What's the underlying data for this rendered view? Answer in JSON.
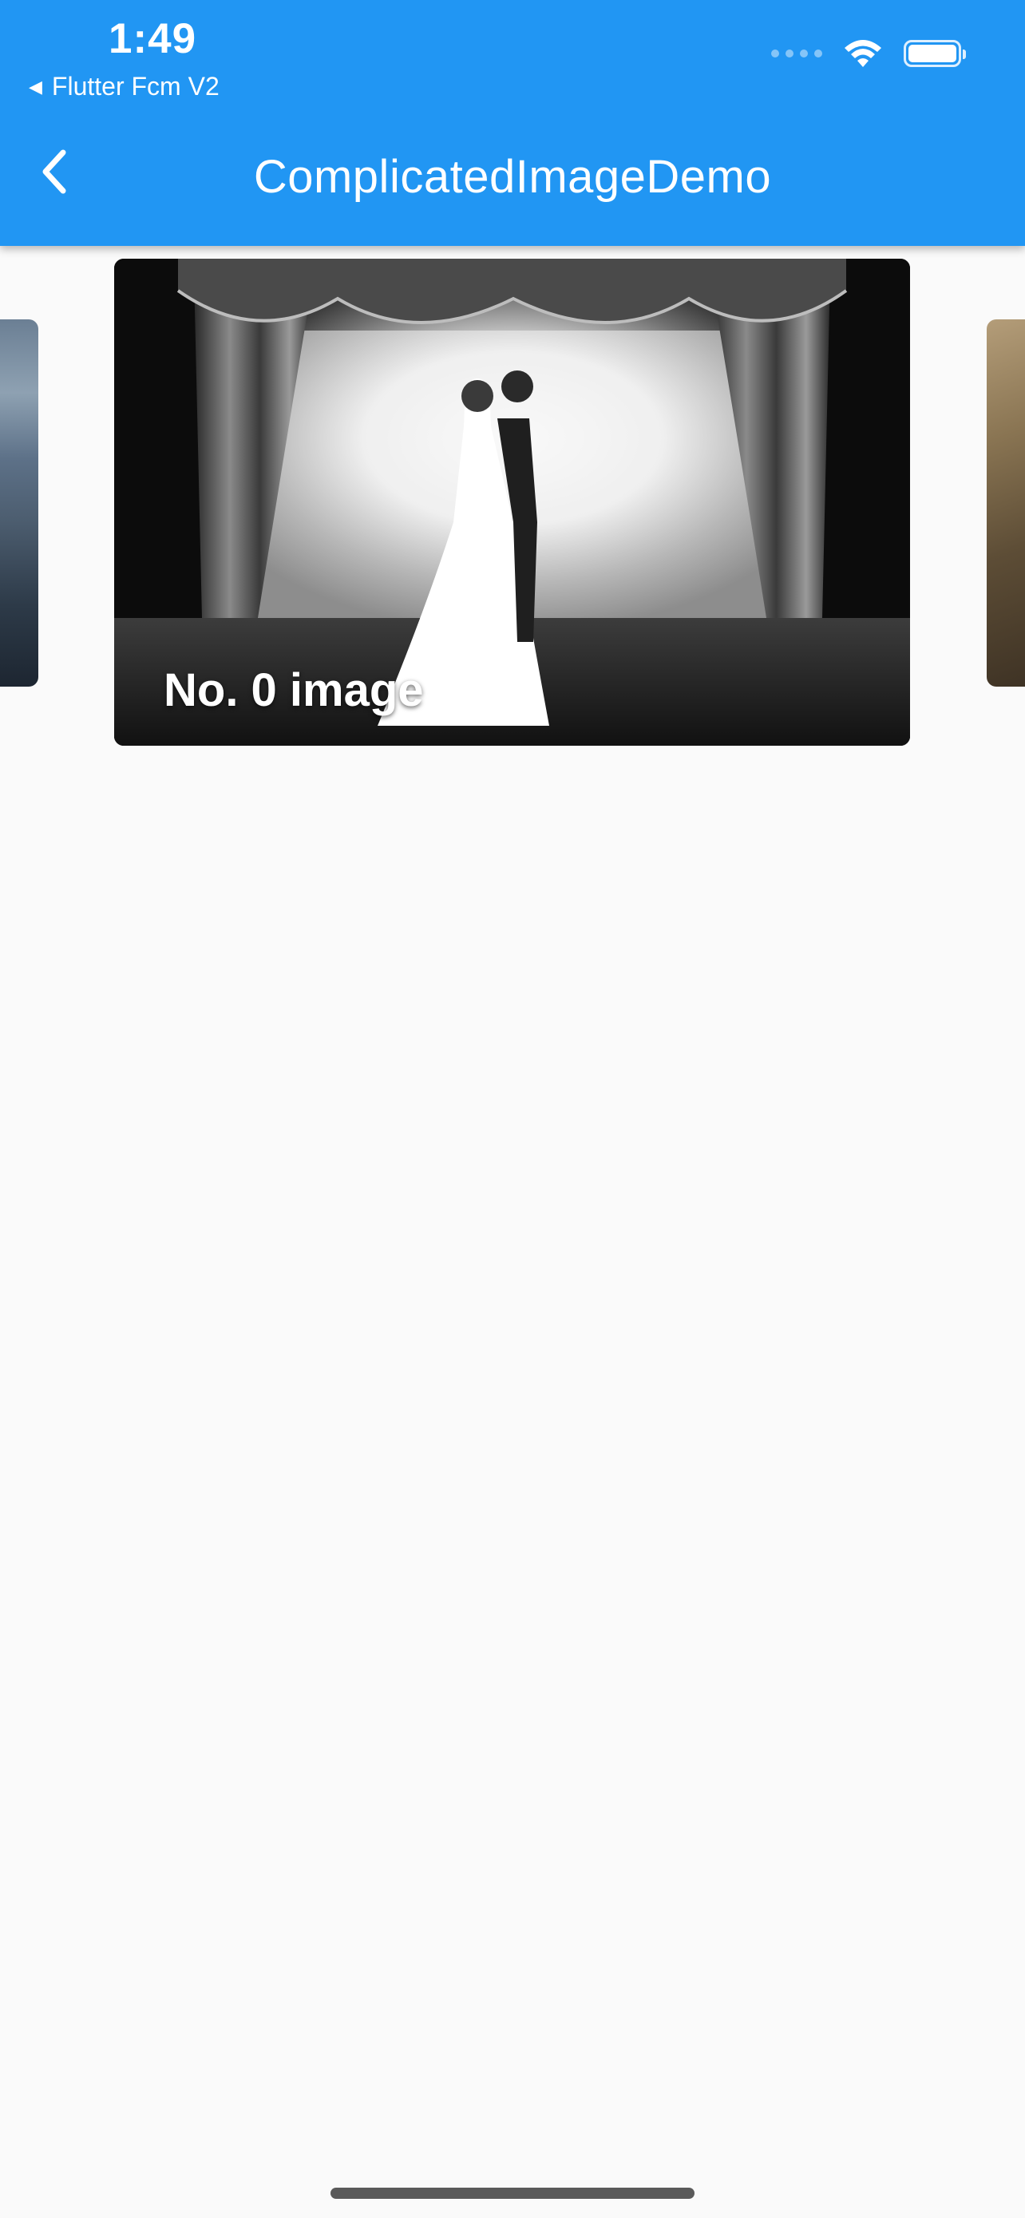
{
  "status_bar": {
    "time": "1:49",
    "back_app_label": "Flutter Fcm V2",
    "back_app_icon": "back-triangle-icon"
  },
  "app_bar": {
    "title": "ComplicatedImageDemo",
    "back_icon": "chevron-left-icon",
    "color": "#2196f3"
  },
  "carousel": {
    "current": {
      "caption": "No. 0 image"
    }
  }
}
